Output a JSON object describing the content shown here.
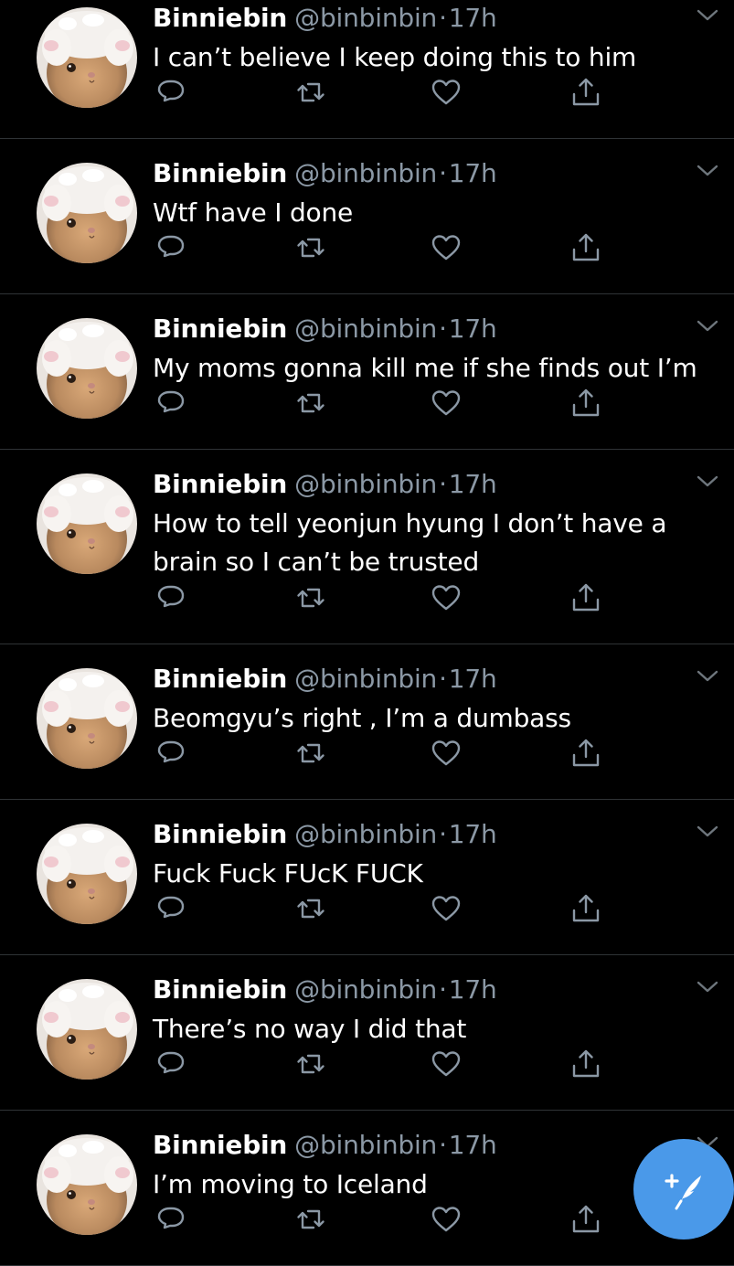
{
  "colors": {
    "background": "#000000",
    "secondary_text": "#8b98a5",
    "divider": "#2f3336",
    "accent": "#4a99e9"
  },
  "icons": {
    "reply": "reply-icon",
    "retweet": "retweet-icon",
    "like": "like-icon",
    "share": "share-icon",
    "more": "chevron-down-icon",
    "compose": "compose-tweet-icon"
  },
  "tweets": [
    {
      "name": "Binniebin",
      "handle": "@binbinbin",
      "dot": "·",
      "time": "17h",
      "text": "I can’t believe I keep doing this to him"
    },
    {
      "name": "Binniebin",
      "handle": "@binbinbin",
      "dot": "·",
      "time": "17h",
      "text": "Wtf have I done"
    },
    {
      "name": "Binniebin",
      "handle": "@binbinbin",
      "dot": "·",
      "time": "17h",
      "text": "My moms gonna kill me if she finds out I’m"
    },
    {
      "name": "Binniebin",
      "handle": "@binbinbin",
      "dot": "·",
      "time": "17h",
      "text": "How to tell yeonjun hyung I don’t have a brain so I can’t be trusted"
    },
    {
      "name": "Binniebin",
      "handle": "@binbinbin",
      "dot": "·",
      "time": "17h",
      "text": "Beomgyu’s right , I’m a dumbass"
    },
    {
      "name": "Binniebin",
      "handle": "@binbinbin",
      "dot": "·",
      "time": "17h",
      "text": "Fuck Fuck FUcK FUCK"
    },
    {
      "name": "Binniebin",
      "handle": "@binbinbin",
      "dot": "·",
      "time": "17h",
      "text": "There’s no way I did that"
    },
    {
      "name": "Binniebin",
      "handle": "@binbinbin",
      "dot": "·",
      "time": "17h",
      "text": "I’m moving to Iceland"
    }
  ]
}
